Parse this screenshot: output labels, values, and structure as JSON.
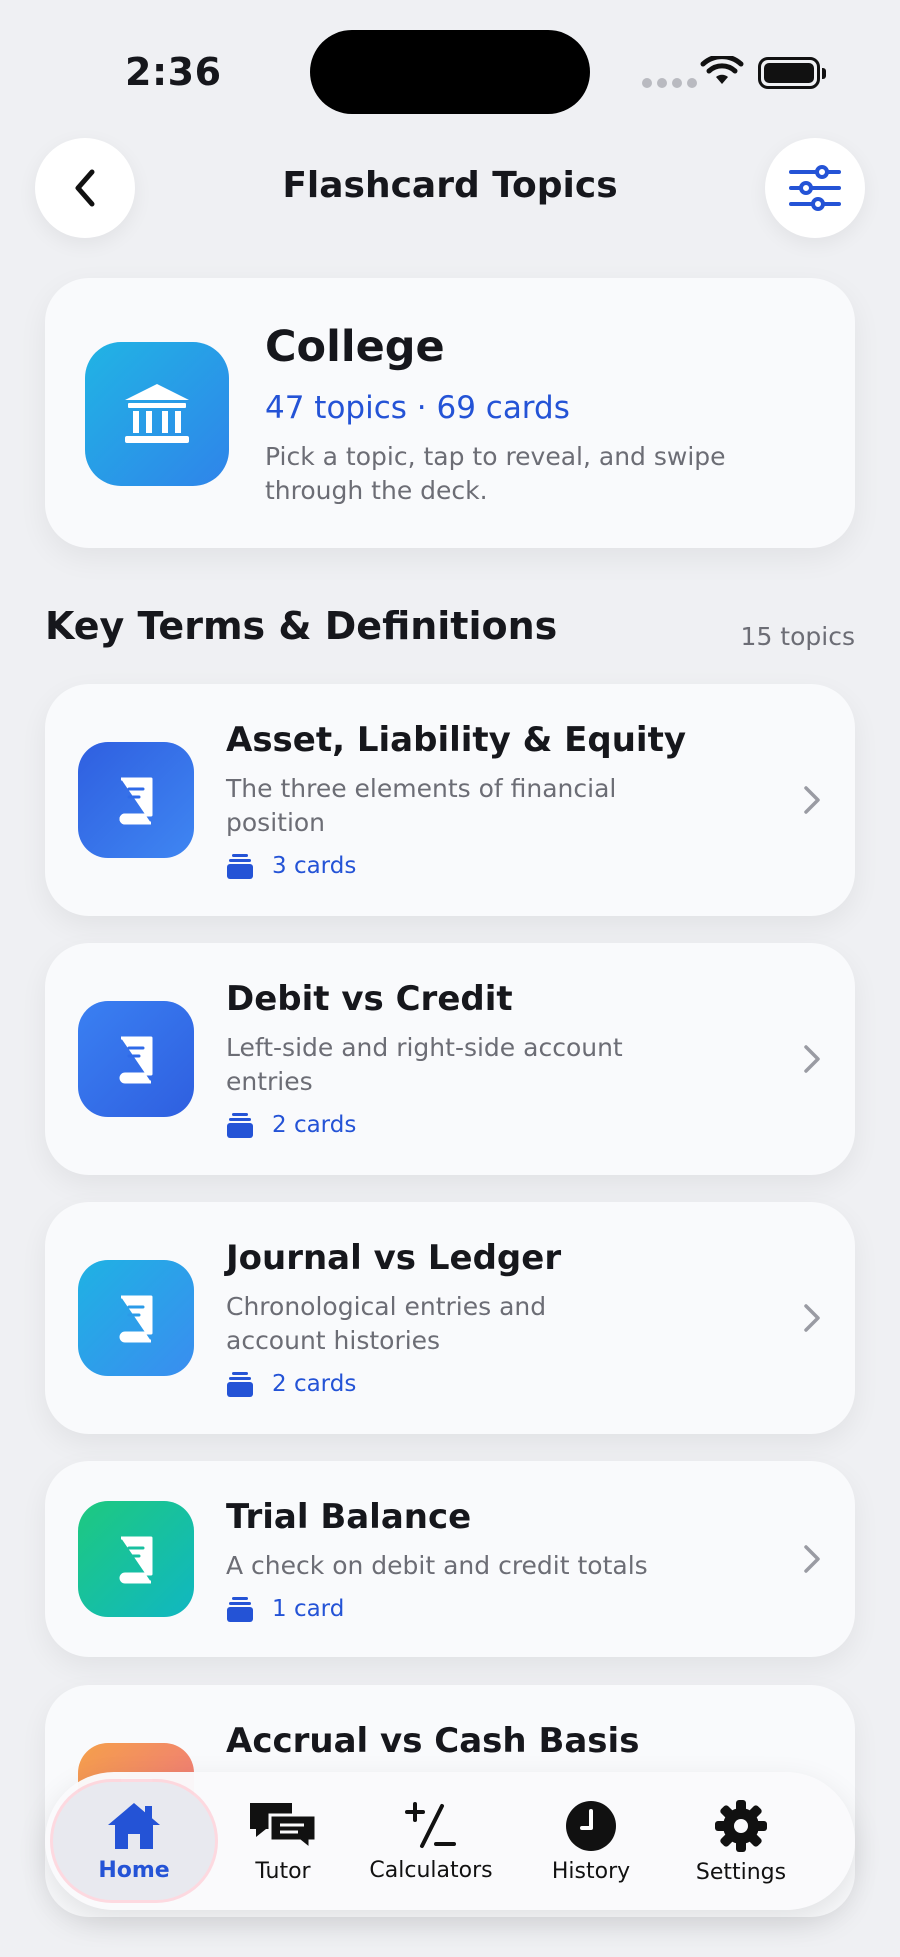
{
  "status": {
    "time": "2:36"
  },
  "nav": {
    "title": "Flashcard Topics"
  },
  "summary": {
    "title": "College",
    "subtitle": "47 topics · 69 cards",
    "description": "Pick a topic, tap to reveal, and swipe through the deck."
  },
  "section": {
    "title": "Key Terms & Definitions",
    "count": "15 topics"
  },
  "topics": [
    {
      "title": "Asset, Liability & Equity",
      "description": "The three elements of financial position",
      "cards": "3 cards",
      "icon": "book-icon",
      "color_from": "#2f5fe0",
      "color_to": "#3f86f2"
    },
    {
      "title": "Debit vs Credit",
      "description": "Left-side and right-side account entries",
      "cards": "2 cards",
      "icon": "book-icon",
      "color_from": "#3478f0",
      "color_to": "#2f62e6"
    },
    {
      "title": "Journal vs Ledger",
      "description": "Chronological entries and account histories",
      "cards": "2 cards",
      "icon": "book-icon",
      "color_from": "#1fb2e3",
      "color_to": "#3a8df0"
    },
    {
      "title": "Trial Balance",
      "description": "A check on debit and credit totals",
      "cards": "1 card",
      "icon": "book-icon",
      "color_from": "#1ec97f",
      "color_to": "#10b7c2"
    },
    {
      "title": "Accrual vs Cash Basis",
      "description": "",
      "cards": "",
      "icon": "book-icon",
      "color_from": "#f5a04a",
      "color_to": "#ee6f8a"
    }
  ],
  "tabs": [
    {
      "label": "Home",
      "icon": "home-icon"
    },
    {
      "label": "Tutor",
      "icon": "chat-icon"
    },
    {
      "label": "Calculators",
      "icon": "plus-minus-icon"
    },
    {
      "label": "History",
      "icon": "clock-icon"
    },
    {
      "label": "Settings",
      "icon": "gear-icon"
    }
  ],
  "colors": {
    "accent": "#2453d6",
    "background": "#eff0f3",
    "card": "#f9fafc"
  }
}
